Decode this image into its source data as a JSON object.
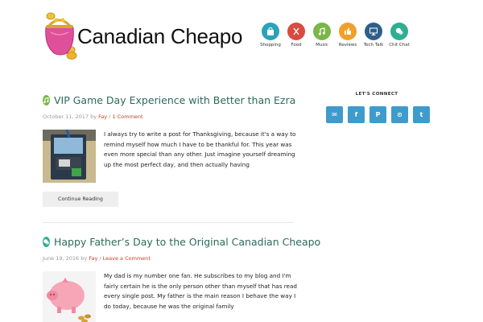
{
  "site": {
    "title": "Canadian Cheapo"
  },
  "categories": [
    {
      "label": "Shopping",
      "icon": "shopping-bag-icon",
      "color": "#2aa2b8"
    },
    {
      "label": "Food",
      "icon": "fork-knife-icon",
      "color": "#d94a3f"
    },
    {
      "label": "Music",
      "icon": "music-note-icon",
      "color": "#7ab648"
    },
    {
      "label": "Reviews",
      "icon": "thumbs-up-icon",
      "color": "#f0a02a"
    },
    {
      "label": "Tech Talk",
      "icon": "monitor-icon",
      "color": "#2e5f8a"
    },
    {
      "label": "Chit Chat",
      "icon": "chat-bubble-icon",
      "color": "#2fae93"
    }
  ],
  "posts": [
    {
      "title": "VIP Game Day Experience with Better than Ezra",
      "date": "October 11, 2017",
      "by": "by",
      "author": "Fay",
      "sep": "/",
      "comments": "1 Comment",
      "icon": "music-note-icon",
      "excerpt": "I always try to write a post for Thanksgiving, because it's a way to remind myself how much I have to be thankful for. This year was even more special than any other.  Just imagine yourself dreaming up the most perfect day, and then actually having",
      "continue": "Continue Reading"
    },
    {
      "title": "Happy Father’s Day to the Original Canadian Cheapo",
      "date": "June 19, 2016",
      "by": "by",
      "author": "Fay",
      "sep": "/",
      "comments": "Leave a Comment",
      "icon": "chit-chat-icon",
      "excerpt": "My dad is my number one fan. He subscribes to my blog and I'm fairly certain he is the only person other than myself that has read every single post. My father is the main reason I behave the way I do today, because he was the original family"
    }
  ],
  "sidebar": {
    "connect_title": "LET'S CONNECT",
    "social": [
      {
        "icon": "email-icon",
        "glyph": "✉"
      },
      {
        "icon": "facebook-icon",
        "glyph": "f"
      },
      {
        "icon": "pinterest-icon",
        "glyph": "P"
      },
      {
        "icon": "rss-icon",
        "glyph": "⊙"
      },
      {
        "icon": "twitter-icon",
        "glyph": "t"
      }
    ]
  },
  "colors": {
    "accent": "#2a6b58",
    "link": "#c5402b",
    "social": "#3f9bcc"
  }
}
